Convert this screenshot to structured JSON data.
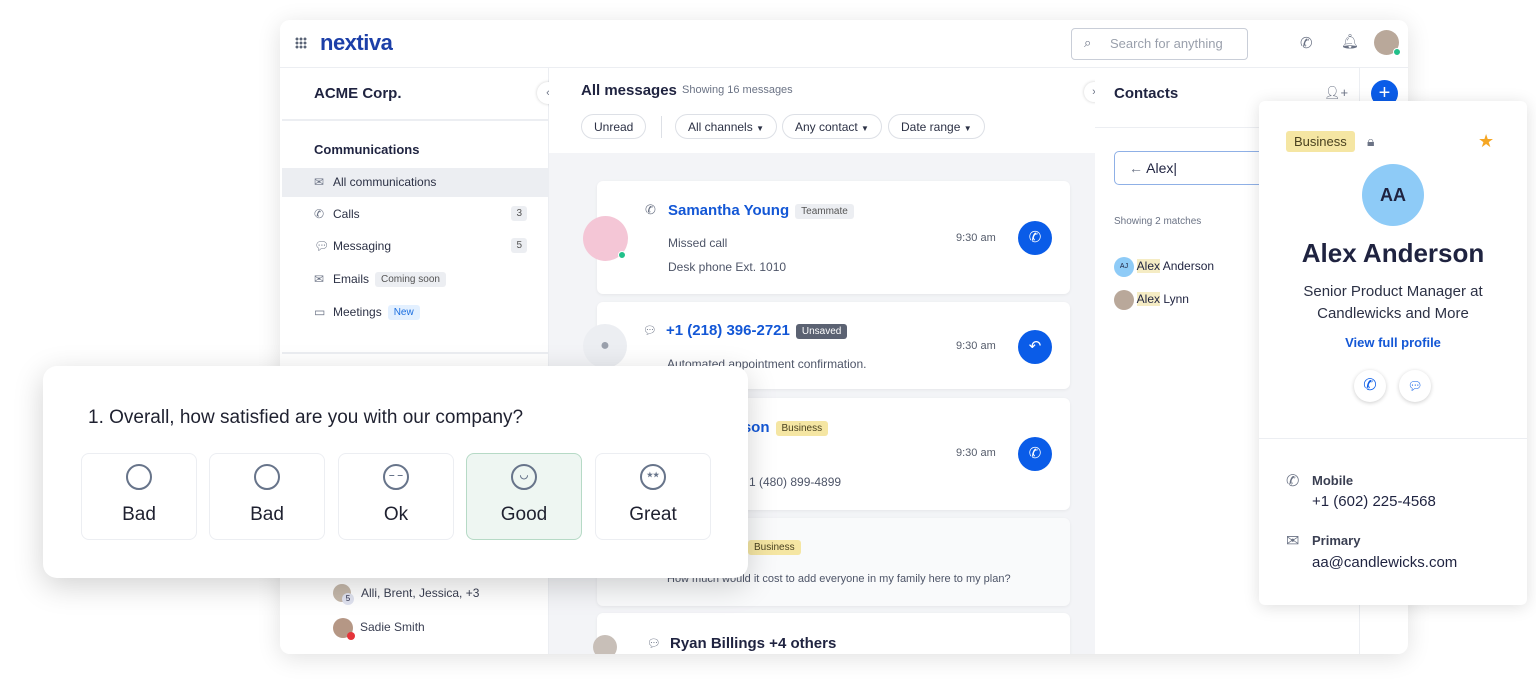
{
  "header": {
    "logo": "nextiva",
    "search_placeholder": "Search for anything"
  },
  "sidebar": {
    "org": "ACME Corp.",
    "section": "Communications",
    "items": [
      {
        "label": "All communications",
        "icon": "inbox-icon"
      },
      {
        "label": "Calls",
        "count": "3",
        "icon": "phone-icon"
      },
      {
        "label": "Messaging",
        "count": "5",
        "icon": "chat-icon"
      },
      {
        "label": "Emails",
        "badge": "Coming soon",
        "icon": "mail-icon"
      },
      {
        "label": "Meetings",
        "badge": "New",
        "icon": "video-icon"
      }
    ],
    "conversations": [
      {
        "label": "Alli, Brent, Jessica, +3",
        "count": "5"
      },
      {
        "label": "Sadie Smith"
      }
    ]
  },
  "messages": {
    "title": "All messages",
    "subtitle": "Showing 16 messages",
    "filters": [
      "Unread",
      "All channels",
      "Any contact",
      "Date range"
    ],
    "cards": [
      {
        "name": "Samantha Young",
        "tag": "Teammate",
        "line1": "Missed call",
        "line2": "Desk phone Ext. 1010",
        "time": "9:30 am"
      },
      {
        "name": "+1 (218) 396-2721",
        "tag": "Unsaved",
        "line1": "Automated appointment confirmation.",
        "time": "9:30 am"
      },
      {
        "name": "rson",
        "tag": "Business",
        "line2": "1 (480) 899-4899",
        "time": "9:30 am"
      },
      {
        "tag": "Business",
        "line1": "How much would it cost to add everyone in my family here to my plan?"
      },
      {
        "name": "Ryan Billings +4 others"
      }
    ]
  },
  "contacts": {
    "title": "Contacts",
    "search_value": "Alex|",
    "matches": "Showing 2 matches",
    "results": [
      {
        "initials": "AJ",
        "highlight": "Alex",
        "rest": " Anderson"
      },
      {
        "highlight": "Alex",
        "rest": " Lynn"
      }
    ]
  },
  "contact_card": {
    "tag": "Business",
    "initials": "AA",
    "name": "Alex Anderson",
    "title_line1": "Senior Product Manager at",
    "title_line2": "Candlewicks and More",
    "link": "View full profile",
    "mobile_label": "Mobile",
    "mobile": "+1 (602) 225-4568",
    "primary_label": "Primary",
    "email": "aa@candlewicks.com"
  },
  "survey": {
    "question": "1. Overall, how satisfied are you with our company?",
    "options": [
      {
        "label": "Bad",
        "face": "o"
      },
      {
        "label": "Bad",
        "face": "o"
      },
      {
        "label": "Ok",
        "face": "–"
      },
      {
        "label": "Good",
        "face": "◡"
      },
      {
        "label": "Great",
        "face": "★★"
      }
    ],
    "selected": "Good"
  },
  "colors": {
    "accent": "#0a5ce8",
    "brand": "#1c3fa8",
    "business_tag": "#f5e6a3",
    "selected_option": "#eef6f2"
  }
}
